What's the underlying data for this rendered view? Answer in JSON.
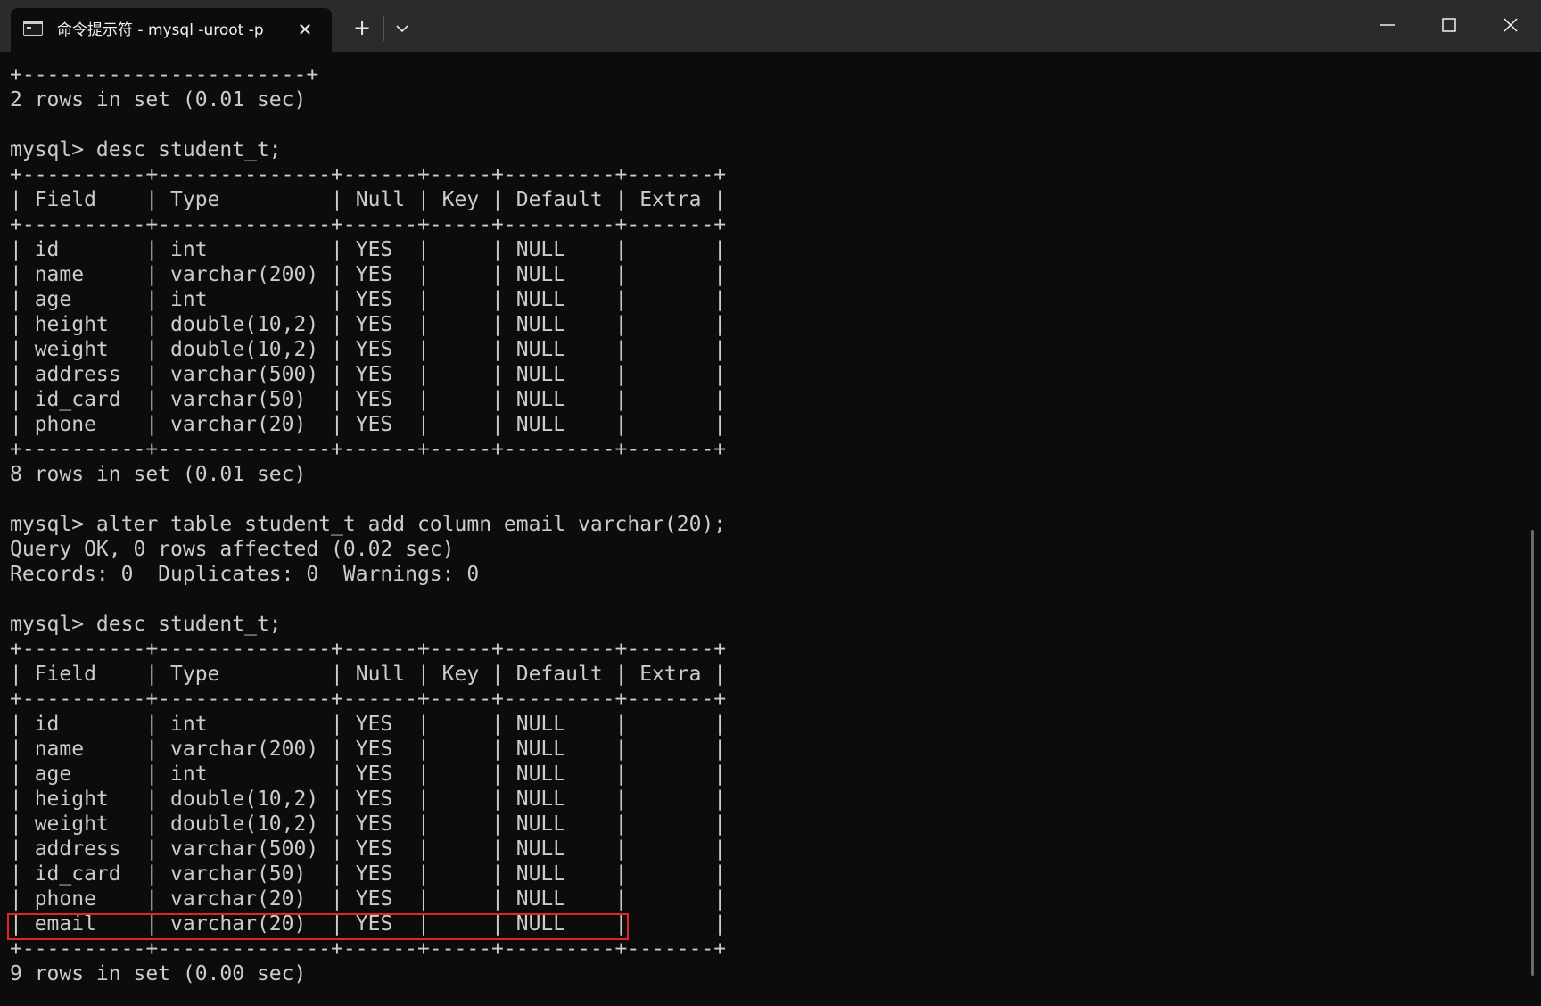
{
  "window": {
    "tab_title": "命令提示符 - mysql  -uroot  -p",
    "tab_close": "✕",
    "new_tab": "+"
  },
  "console_lines": [
    "+-----------------------+",
    "2 rows in set (0.01 sec)",
    "",
    "mysql> desc student_t;",
    "+----------+--------------+------+-----+---------+-------+",
    "| Field    | Type         | Null | Key | Default | Extra |",
    "+----------+--------------+------+-----+---------+-------+",
    "| id       | int          | YES  |     | NULL    |       |",
    "| name     | varchar(200) | YES  |     | NULL    |       |",
    "| age      | int          | YES  |     | NULL    |       |",
    "| height   | double(10,2) | YES  |     | NULL    |       |",
    "| weight   | double(10,2) | YES  |     | NULL    |       |",
    "| address  | varchar(500) | YES  |     | NULL    |       |",
    "| id_card  | varchar(50)  | YES  |     | NULL    |       |",
    "| phone    | varchar(20)  | YES  |     | NULL    |       |",
    "+----------+--------------+------+-----+---------+-------+",
    "8 rows in set (0.01 sec)",
    "",
    "mysql> alter table student_t add column email varchar(20);",
    "Query OK, 0 rows affected (0.02 sec)",
    "Records: 0  Duplicates: 0  Warnings: 0",
    "",
    "mysql> desc student_t;",
    "+----------+--------------+------+-----+---------+-------+",
    "| Field    | Type         | Null | Key | Default | Extra |",
    "+----------+--------------+------+-----+---------+-------+",
    "| id       | int          | YES  |     | NULL    |       |",
    "| name     | varchar(200) | YES  |     | NULL    |       |",
    "| age      | int          | YES  |     | NULL    |       |",
    "| height   | double(10,2) | YES  |     | NULL    |       |",
    "| weight   | double(10,2) | YES  |     | NULL    |       |",
    "| address  | varchar(500) | YES  |     | NULL    |       |",
    "| id_card  | varchar(50)  | YES  |     | NULL    |       |",
    "| phone    | varchar(20)  | YES  |     | NULL    |       |",
    "| email    | varchar(20)  | YES  |     | NULL    |       |",
    "+----------+--------------+------+-----+---------+-------+",
    "9 rows in set (0.00 sec)"
  ],
  "colors": {
    "background": "#0c0c0c",
    "titlebar": "#2b2b2b",
    "text": "#cccccc",
    "highlight": "#e0252a"
  },
  "icons": {
    "tab": "terminal-icon",
    "dropdown": "chevron-down-icon",
    "minimize": "minimize-icon",
    "maximize": "maximize-icon",
    "close": "close-icon"
  }
}
